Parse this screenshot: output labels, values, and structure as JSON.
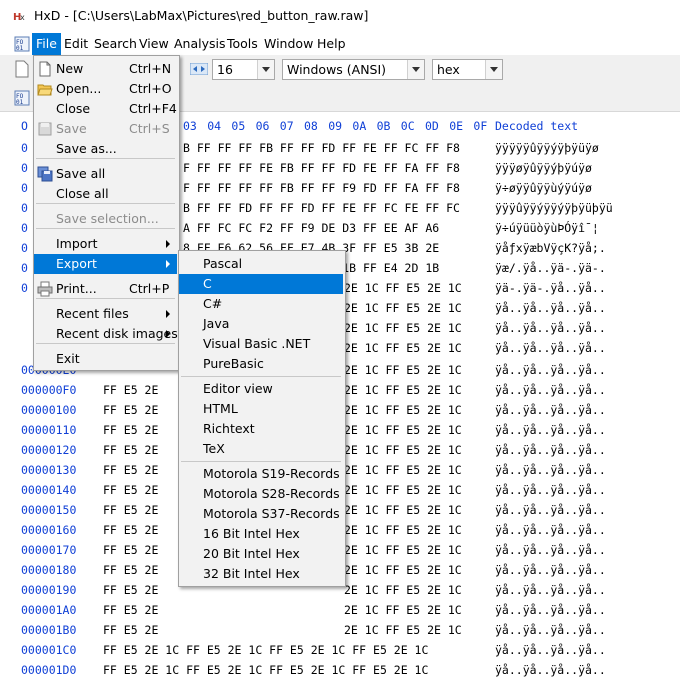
{
  "window": {
    "title": "HxD - [C:\\Users\\LabMax\\Pictures\\red_button_raw.raw]"
  },
  "menubar": [
    "File",
    "Edit",
    "Search",
    "View",
    "Analysis",
    "Tools",
    "Window",
    "Help"
  ],
  "toolbar": {
    "bytes_per_row": "16",
    "charset": "Windows (ANSI)",
    "offset_base": "hex"
  },
  "hex_view": {
    "header_offset_label": "O",
    "header_visible_columns": [
      "03",
      "04",
      "05",
      "06",
      "07",
      "08",
      "09",
      "0A",
      "0B",
      "0C",
      "0D",
      "0E",
      "0F"
    ],
    "decoded_header": "Decoded text",
    "top_rows": [
      {
        "prefix": "0",
        "hex": "B FF FF FF FB FF FF FD FF FE FF FC FF F8",
        "text": "ÿÿÿÿÿûÿÿýÿþÿüÿø"
      },
      {
        "prefix": "0",
        "hex": "F FF FF FF FE FB FF FF FD FE FF FA FF F8",
        "text": "ÿÿÿøÿûÿÿýþÿúÿø"
      },
      {
        "prefix": "0",
        "hex": "F FF FF FF FF FB FF FF F9 FD FF FA FF F8",
        "text": "ÿ÷øÿÿûÿÿùýÿúÿø"
      },
      {
        "prefix": "0",
        "hex": "B FF FF FD FF FF FD FF FE FF FC FE FF FC",
        "text": "ÿÿÿûÿÿýÿÿýÿþÿüþÿü"
      },
      {
        "prefix": "0",
        "hex": "A FF FC FC F2 FF F9 DE D3 FF EE AF A6",
        "text": "ÿ÷úÿüüòÿùÞÓÿî¯¦"
      },
      {
        "prefix": "0",
        "hex": "8 FF E6 62 56 FF E7 4B 3F FF E5 3B 2E",
        "text": "ÿåƒxÿæbVÿçK?ÿå;."
      },
      {
        "prefix": "0",
        "hex": "F FF E5 2E 1C FF E4 2D 1B FF E4 2D 1B",
        "text": "ÿæ/.ÿå..ÿä-.ÿä-."
      },
      {
        "prefix": "0",
        "hex": "2E 1C FF E5 2E 1C",
        "text": "ÿä-.ÿä-.ÿå..ÿå.."
      }
    ],
    "rows": [
      {
        "offset": "000000F0",
        "hex": "FF E5 2E",
        "hex_right": "2E 1C FF E5 2E 1C",
        "text": "ÿå..ÿå..ÿå..ÿå.."
      },
      {
        "offset": "00000100",
        "hex": "FF E5 2E",
        "hex_right": "2E 1C FF E5 2E 1C",
        "text": "ÿå..ÿå..ÿå..ÿå.."
      },
      {
        "offset": "00000110",
        "hex": "FF E5 2E",
        "hex_right": "2E 1C FF E5 2E 1C",
        "text": "ÿå..ÿå..ÿå..ÿå.."
      },
      {
        "offset": "00000120",
        "hex": "FF E5 2E",
        "hex_right": "2E 1C FF E5 2E 1C",
        "text": "ÿå..ÿå..ÿå..ÿå.."
      },
      {
        "offset": "00000130",
        "hex": "FF E5 2E",
        "hex_right": "2E 1C FF E5 2E 1C",
        "text": "ÿå..ÿå..ÿå..ÿå.."
      },
      {
        "offset": "00000140",
        "hex": "FF E5 2E",
        "hex_right": "2E 1C FF E5 2E 1C",
        "text": "ÿå..ÿå..ÿå..ÿå.."
      },
      {
        "offset": "00000150",
        "hex": "FF E5 2E",
        "hex_right": "2E 1C FF E5 2E 1C",
        "text": "ÿå..ÿå..ÿå..ÿå.."
      },
      {
        "offset": "00000160",
        "hex": "FF E5 2E",
        "hex_right": "2E 1C FF E5 2E 1C",
        "text": "ÿå..ÿå..ÿå..ÿå.."
      },
      {
        "offset": "00000170",
        "hex": "FF E5 2E",
        "hex_right": "2E 1C FF E5 2E 1C",
        "text": "ÿå..ÿå..ÿå..ÿå.."
      },
      {
        "offset": "00000180",
        "hex": "FF E5 2E",
        "hex_right": "2E 1C FF E5 2E 1C",
        "text": "ÿå..ÿå..ÿå..ÿå.."
      },
      {
        "offset": "00000190",
        "hex": "FF E5 2E",
        "hex_right": "2E 1C FF E5 2E 1C",
        "text": "ÿå..ÿå..ÿå..ÿå.."
      },
      {
        "offset": "000001A0",
        "hex": "FF E5 2E",
        "hex_right": "2E 1C FF E5 2E 1C",
        "text": "ÿå..ÿå..ÿå..ÿå.."
      },
      {
        "offset": "000001B0",
        "hex": "FF E5 2E",
        "hex_right": "2E 1C FF E5 2E 1C",
        "text": "ÿå..ÿå..ÿå..ÿå.."
      },
      {
        "offset": "000001C0",
        "hex": "FF E5 2E 1C FF E5 2E 1C FF E5 2E 1C FF E5 2E 1C",
        "hex_right": "",
        "text": "ÿå..ÿå..ÿå..ÿå.."
      },
      {
        "offset": "000001D0",
        "hex": "FF E5 2E 1C FF E5 2E 1C FF E5 2E 1C FF E5 2E 1C",
        "hex_right": "",
        "text": "ÿå..ÿå..ÿå..ÿå.."
      }
    ],
    "partial_row_offset": "000000E0"
  },
  "file_menu": {
    "items": [
      {
        "label": "New",
        "shortcut": "Ctrl+N",
        "icon": "new-file-icon",
        "disabled": false
      },
      {
        "label": "Open...",
        "shortcut": "Ctrl+O",
        "icon": "open-folder-icon",
        "disabled": false
      },
      {
        "label": "Close",
        "shortcut": "Ctrl+F4",
        "icon": "",
        "disabled": false
      },
      {
        "label": "Save",
        "shortcut": "Ctrl+S",
        "icon": "save-disk-icon",
        "disabled": true
      },
      {
        "label": "Save as...",
        "shortcut": "",
        "icon": "",
        "disabled": false
      },
      {
        "label": "Save all",
        "shortcut": "",
        "icon": "save-all-icon",
        "disabled": false
      },
      {
        "label": "Close all",
        "shortcut": "",
        "icon": "",
        "disabled": false
      },
      {
        "label": "Save selection...",
        "shortcut": "",
        "icon": "",
        "disabled": true
      },
      {
        "label": "Import",
        "shortcut": "",
        "icon": "",
        "disabled": false,
        "submenu": true
      },
      {
        "label": "Export",
        "shortcut": "",
        "icon": "",
        "disabled": false,
        "submenu": true,
        "highlighted": true
      },
      {
        "label": "Print...",
        "shortcut": "Ctrl+P",
        "icon": "printer-icon",
        "disabled": false
      },
      {
        "label": "Recent files",
        "shortcut": "",
        "icon": "",
        "disabled": false,
        "submenu": true
      },
      {
        "label": "Recent disk images",
        "shortcut": "",
        "icon": "",
        "disabled": false,
        "submenu": true
      },
      {
        "label": "Exit",
        "shortcut": "",
        "icon": "",
        "disabled": false
      }
    ]
  },
  "export_menu": {
    "groups": [
      [
        "Pascal",
        "C",
        "C#",
        "Java",
        "Visual Basic .NET",
        "PureBasic"
      ],
      [
        "Editor view",
        "HTML",
        "Richtext",
        "TeX"
      ],
      [
        "Motorola S19-Records",
        "Motorola S28-Records",
        "Motorola S37-Records",
        "16 Bit Intel Hex",
        "20 Bit Intel Hex",
        "32 Bit Intel Hex"
      ]
    ],
    "highlighted": "C"
  },
  "colors": {
    "accent": "#0078d7",
    "hex_label": "#0f3fd6"
  }
}
